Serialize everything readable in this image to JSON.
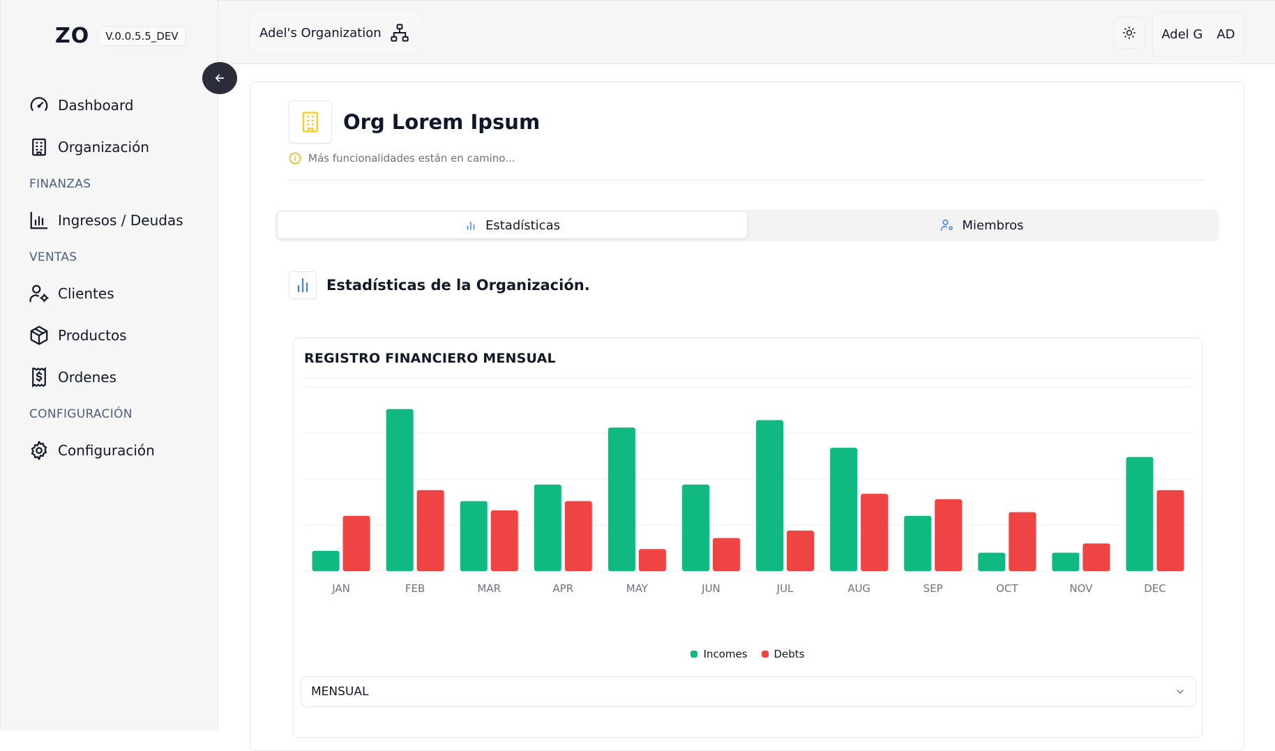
{
  "sidebar": {
    "brand": "ZO",
    "version": "V.0.0.5.5_DEV",
    "items": [
      {
        "label": "Dashboard",
        "icon": "gauge-icon"
      },
      {
        "label": "Organización",
        "icon": "building-icon"
      },
      {
        "label": "Ingresos / Deudas",
        "icon": "bar-chart-icon"
      },
      {
        "label": "Clientes",
        "icon": "user-cog-icon"
      },
      {
        "label": "Productos",
        "icon": "package-icon"
      },
      {
        "label": "Ordenes",
        "icon": "receipt-icon"
      },
      {
        "label": "Configuración",
        "icon": "gear-icon"
      }
    ],
    "sections": [
      "FINANZAS",
      "VENTAS",
      "CONFIGURACIÓN"
    ]
  },
  "header": {
    "org_name": "Adel's Organization",
    "user_name": "Adel G",
    "user_initials": "AD"
  },
  "main": {
    "org_title": "Org Lorem Ipsum",
    "note": "Más funcionalidades están en camino...",
    "tabs": [
      {
        "label": "Estadísticas",
        "active": true
      },
      {
        "label": "Miembros",
        "active": false
      }
    ],
    "stats_title": "Estadísticas de la Organización.",
    "period_select": "MENSUAL"
  },
  "colors": {
    "income": "#10b981",
    "debt": "#ef4444",
    "accent_blue": "#3b82f6",
    "accent_yellow": "#facc15"
  },
  "chart_data": {
    "type": "bar",
    "title": "REGISTRO FINANCIERO MENSUAL",
    "categories": [
      "JAN",
      "FEB",
      "MAR",
      "APR",
      "MAY",
      "JUN",
      "JUL",
      "AUG",
      "SEP",
      "OCT",
      "NOV",
      "DEC"
    ],
    "series": [
      {
        "name": "Incomes",
        "values": [
          11,
          88,
          38,
          47,
          78,
          47,
          82,
          67,
          30,
          10,
          10,
          62
        ]
      },
      {
        "name": "Debts",
        "values": [
          30,
          44,
          33,
          38,
          12,
          18,
          22,
          42,
          39,
          32,
          15,
          44
        ]
      }
    ],
    "ylim": [
      0,
      100
    ],
    "grid": true,
    "legend": "bottom"
  }
}
